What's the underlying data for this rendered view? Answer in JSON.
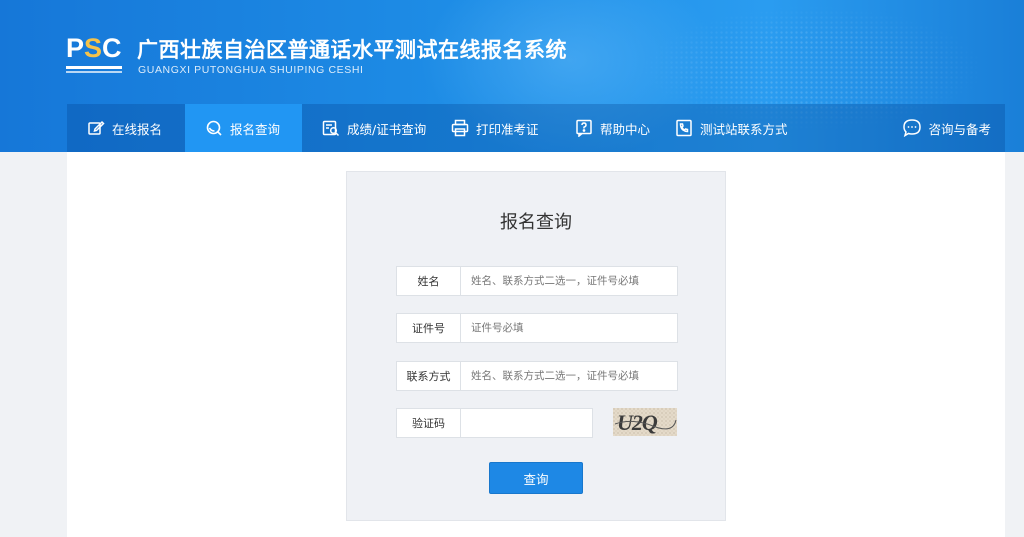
{
  "header": {
    "logo_text": "PSC",
    "title": "广西壮族自治区普通话水平测试在线报名系统",
    "subtitle": "GUANGXI PUTONGHUA SHUIPING CESHI"
  },
  "nav": {
    "items": [
      {
        "label": "在线报名",
        "icon": "edit-icon"
      },
      {
        "label": "报名查询",
        "icon": "search-icon",
        "active": true
      },
      {
        "label": "成绩/证书查询",
        "icon": "certificate-search-icon"
      },
      {
        "label": "打印准考证",
        "icon": "printer-icon"
      },
      {
        "label": "帮助中心",
        "icon": "help-icon"
      },
      {
        "label": "测试站联系方式",
        "icon": "contact-phone-icon"
      }
    ],
    "consult_label": "咨询与备考",
    "consult_icon": "chat-icon"
  },
  "form": {
    "title": "报名查询",
    "fields": [
      {
        "label": "姓名",
        "placeholder": "姓名、联系方式二选一，证件号必填",
        "value": ""
      },
      {
        "label": "证件号",
        "placeholder": "证件号必填",
        "value": ""
      },
      {
        "label": "联系方式",
        "placeholder": "姓名、联系方式二选一，证件号必填",
        "value": ""
      },
      {
        "label": "验证码",
        "placeholder": "",
        "value": ""
      }
    ],
    "captcha_text": "U2Q",
    "submit_label": "查询"
  },
  "colors": {
    "header_blue": "#1e8de6",
    "nav_active": "#2196f3",
    "button_blue": "#1e88e5",
    "logo_accent": "#f6c34a"
  }
}
